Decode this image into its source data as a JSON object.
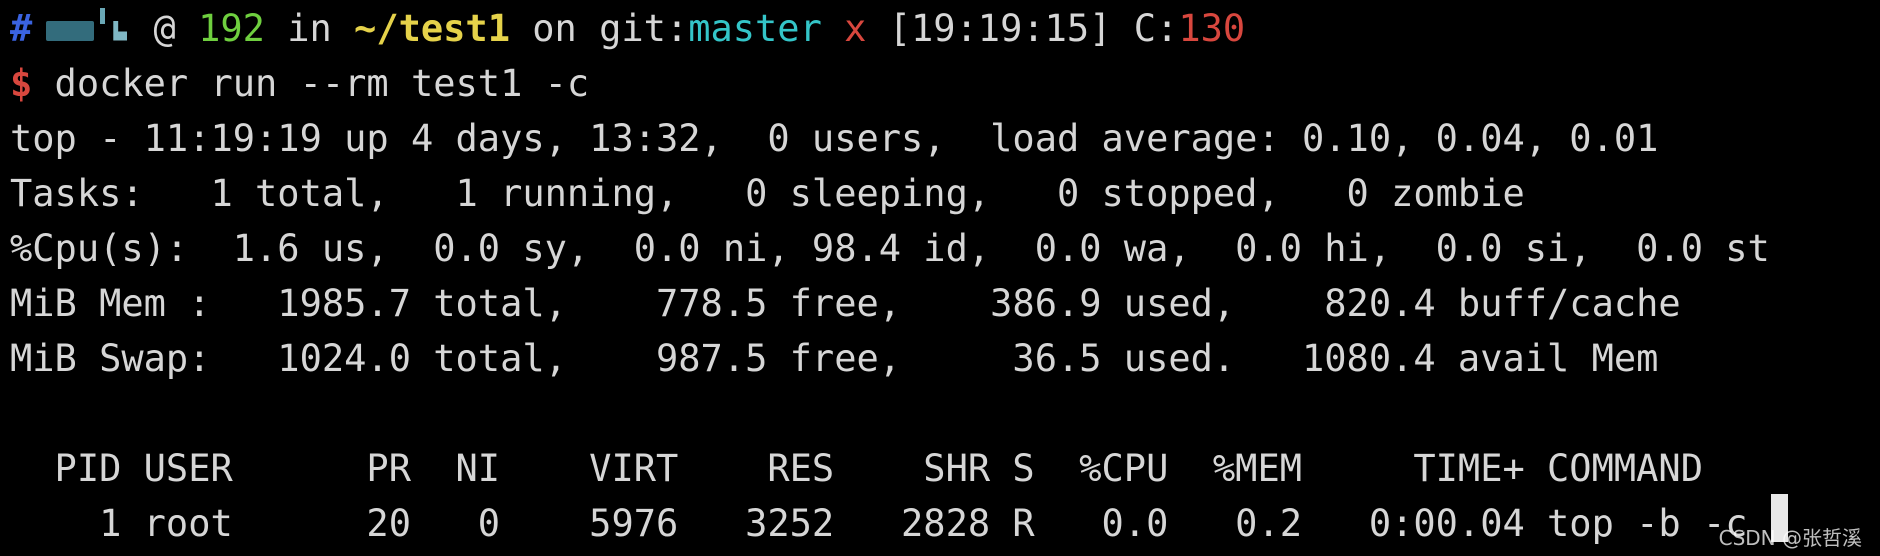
{
  "prompt_line": {
    "hash": "#",
    "at": " @ ",
    "host": "192",
    "in": " in ",
    "dir": "~/test1",
    "on": " on ",
    "git_label": "git:",
    "branch": "master",
    "dirty": "x",
    "time": "[19:19:15]",
    "exit_label": "C:",
    "exit_code": "130"
  },
  "command_line": {
    "prompt_symbol": "$",
    "command": " docker run --rm test1 -c"
  },
  "top_output": {
    "header": "top - 11:19:19 up 4 days, 13:32,  0 users,  load average: 0.10, 0.04, 0.01",
    "tasks": "Tasks:   1 total,   1 running,   0 sleeping,   0 stopped,   0 zombie",
    "cpu": "%Cpu(s):  1.6 us,  0.0 sy,  0.0 ni, 98.4 id,  0.0 wa,  0.0 hi,  0.0 si,  0.0 st",
    "mem": "MiB Mem :   1985.7 total,    778.5 free,    386.9 used,    820.4 buff/cache",
    "swap": "MiB Swap:   1024.0 total,    987.5 free,     36.5 used.   1080.4 avail Mem",
    "columns_header": "  PID USER      PR  NI    VIRT    RES    SHR S  %CPU  %MEM     TIME+ COMMAND",
    "process_row": "    1 root      20   0    5976   3252   2828 R   0.0   0.2   0:00.04 top -b -c"
  },
  "watermark": "CSDN @张哲溪",
  "colors": {
    "background": "#000000",
    "text": "#d6d6d6",
    "hash": "#3a63e0",
    "host": "#6fcf3f",
    "dir": "#e5d24a",
    "branch": "#34c5c8",
    "error": "#d8473e"
  }
}
